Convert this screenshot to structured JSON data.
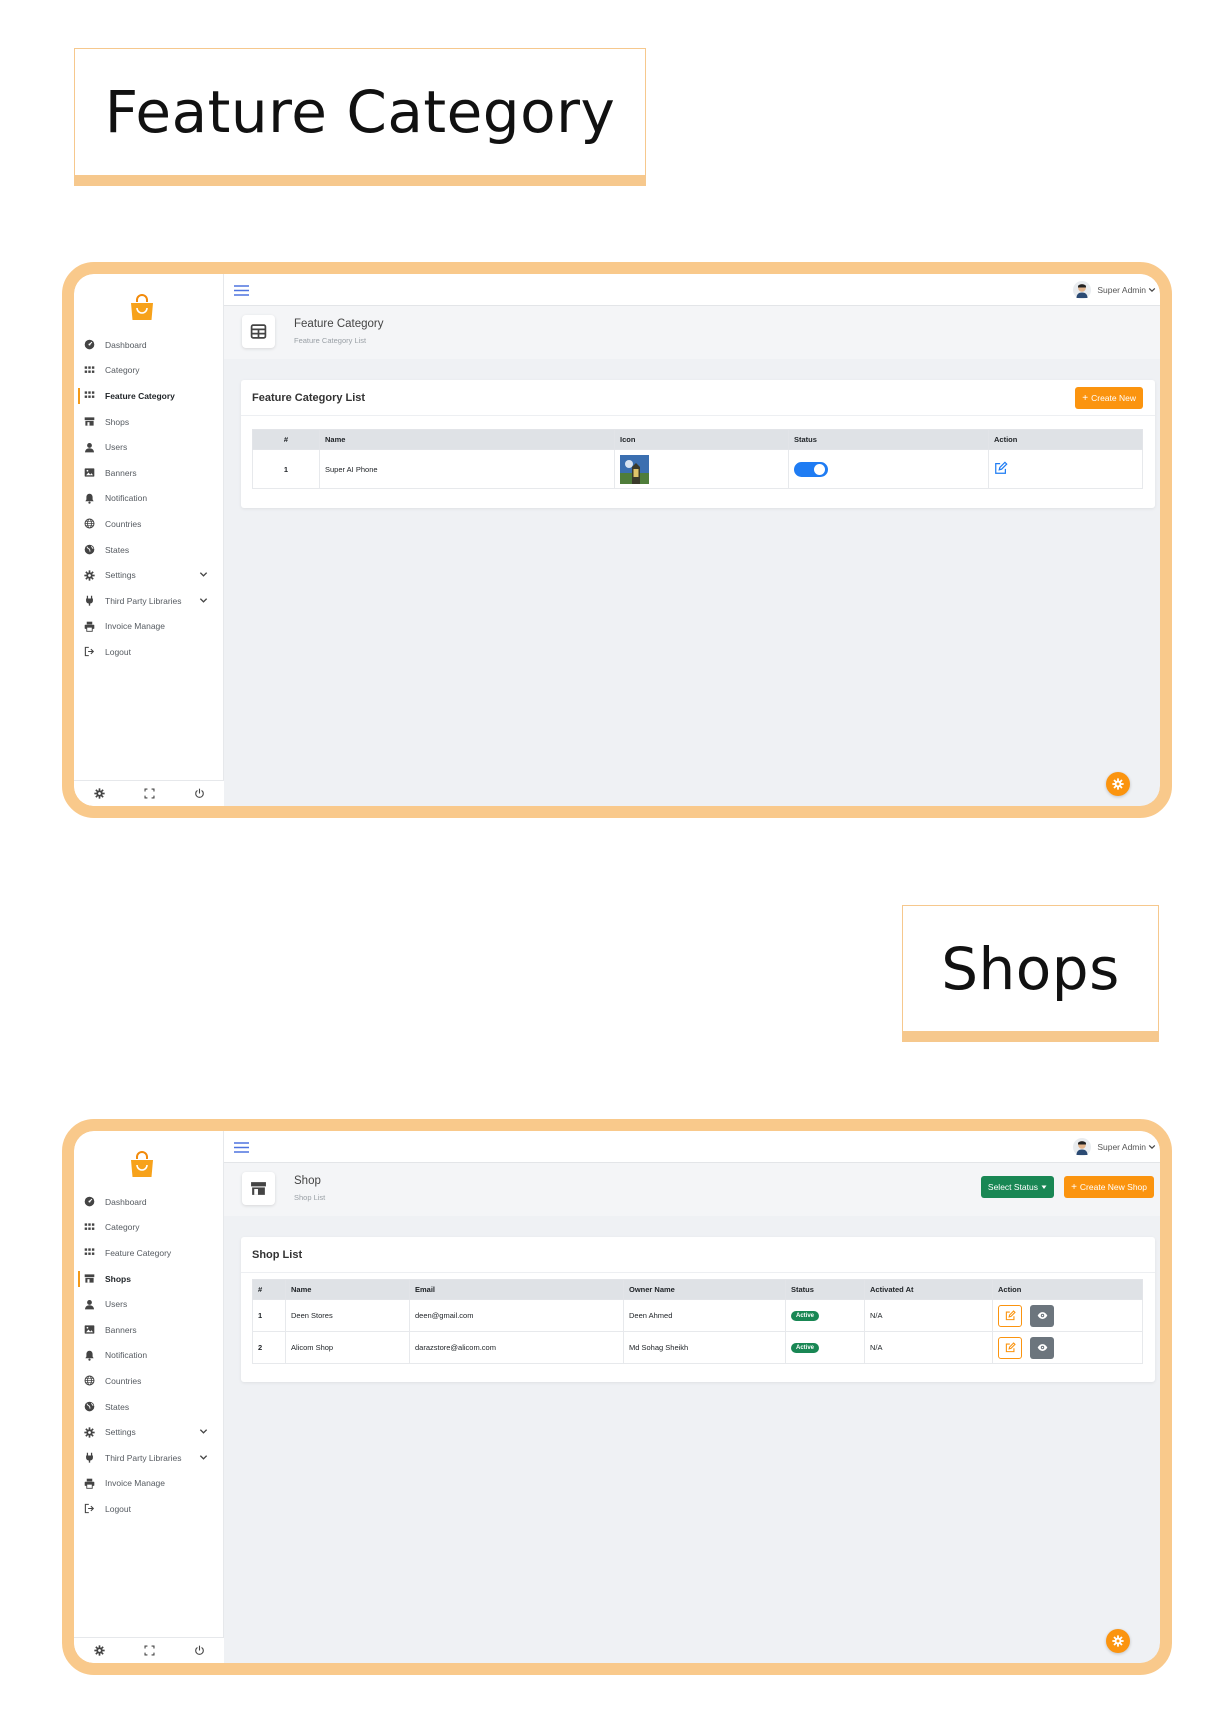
{
  "titles": {
    "feature": "Feature Category",
    "shops": "Shops"
  },
  "nav": [
    {
      "label": "Dashboard",
      "icon": "dashboard-icon"
    },
    {
      "label": "Category",
      "icon": "grid-icon"
    },
    {
      "label": "Feature Category",
      "icon": "grid-icon"
    },
    {
      "label": "Shops",
      "icon": "store-icon"
    },
    {
      "label": "Users",
      "icon": "user-icon"
    },
    {
      "label": "Banners",
      "icon": "image-icon"
    },
    {
      "label": "Notification",
      "icon": "bell-icon"
    },
    {
      "label": "Countries",
      "icon": "globe-icon"
    },
    {
      "label": "States",
      "icon": "globe-americas-icon"
    },
    {
      "label": "Settings",
      "icon": "gear-icon"
    },
    {
      "label": "Third Party Libraries",
      "icon": "plug-icon"
    },
    {
      "label": "Invoice Manage",
      "icon": "printer-icon"
    },
    {
      "label": "Logout",
      "icon": "logout-icon"
    }
  ],
  "topbar": {
    "user_name": "Super Admin"
  },
  "feature_screen": {
    "header_title": "Feature Category",
    "header_subtitle": "Feature Category List",
    "card_title": "Feature Category List",
    "create_button": "Create New",
    "columns": [
      "#",
      "Name",
      "Icon",
      "Status",
      "Action"
    ],
    "rows": [
      {
        "num": "1",
        "name": "Super AI Phone",
        "status_on": true
      }
    ]
  },
  "shop_screen": {
    "header_title": "Shop",
    "header_subtitle": "Shop List",
    "select_status_button": "Select Status",
    "create_button": "Create New Shop",
    "card_title": "Shop List",
    "columns": [
      "#",
      "Name",
      "Email",
      "Owner Name",
      "Status",
      "Activated At",
      "Action"
    ],
    "rows": [
      {
        "num": "1",
        "name": "Deen Stores",
        "email": "deen@gmail.com",
        "owner": "Deen Ahmed",
        "status": "Active",
        "activated": "N/A"
      },
      {
        "num": "2",
        "name": "Alicom Shop",
        "email": "darazstore@alicom.com",
        "owner": "Md Sohag Sheikh",
        "status": "Active",
        "activated": "N/A"
      }
    ]
  },
  "colors": {
    "accent": "#fb940f",
    "frame": "#f9c98b",
    "success": "#198754",
    "toggle": "#1f7cf3"
  }
}
